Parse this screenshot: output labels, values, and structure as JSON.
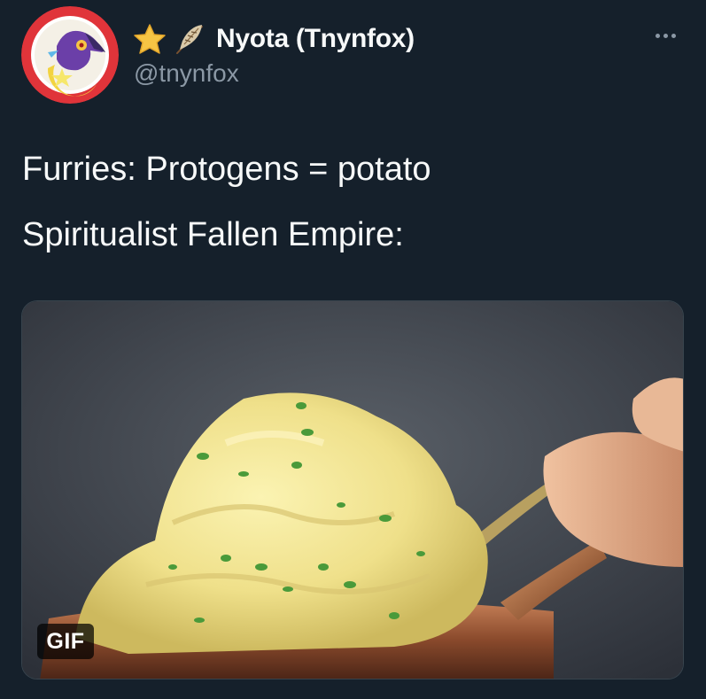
{
  "author": {
    "badge_icons": [
      "star-icon",
      "feather-icon"
    ],
    "display_name": "Nyota (Tnynfox)",
    "handle": "@tnynfox"
  },
  "tweet": {
    "lines": [
      "Furries: Protogens = potato",
      "Spiritualist Fallen Empire:"
    ]
  },
  "media": {
    "type": "gif",
    "badge": "GIF",
    "description_icon": "mashed-potato-spoon-image"
  },
  "colors": {
    "background": "#15202b",
    "text": "#f7f9f9",
    "secondary_text": "#8b98a5",
    "star": "#f6c544",
    "avatar_ring": "#e0343a"
  }
}
